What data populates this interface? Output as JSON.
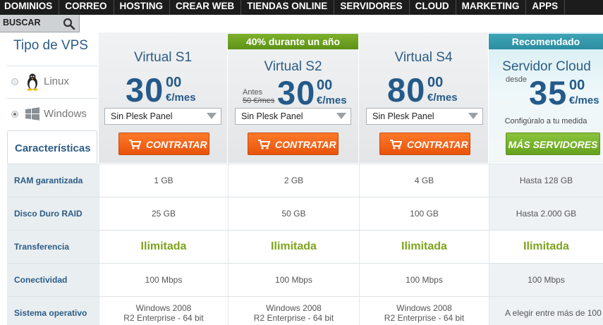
{
  "nav": {
    "items": [
      "DOMINIOS",
      "CORREO",
      "HOSTING",
      "CREAR WEB",
      "TIENDAS ONLINE",
      "SERVIDORES",
      "CLOUD",
      "MARKETING",
      "APPS"
    ]
  },
  "search": {
    "label": "BUSCAR",
    "icon": "search-icon"
  },
  "sidebar": {
    "title": "Tipo de VPS",
    "os_options": [
      {
        "label": "Linux",
        "icon": "linux-icon",
        "selected": false
      },
      {
        "label": "Windows",
        "icon": "windows-icon",
        "selected": true
      }
    ],
    "features_tab": "Características"
  },
  "plans": [
    {
      "name": "Virtual S1",
      "price_int": "30",
      "price_dec": "00",
      "period": "€/mes",
      "select_value": "Sin Plesk Panel",
      "button_label": "CONTRATAR"
    },
    {
      "ribbon": "40% durante un año",
      "name": "Virtual S2",
      "prefix_label": "Antes",
      "prefix_value": "50 €/mes",
      "price_int": "30",
      "price_dec": "00",
      "period": "€/mes",
      "select_value": "Sin Plesk Panel",
      "button_label": "CONTRATAR"
    },
    {
      "name": "Virtual S4",
      "price_int": "80",
      "price_dec": "00",
      "period": "€/mes",
      "select_value": "Sin Plesk Panel",
      "button_label": "CONTRATAR"
    },
    {
      "ribbon": "Recomendado",
      "name": "Servidor Cloud",
      "prefix_label": "desde",
      "price_int": "35",
      "price_dec": "00",
      "period": "€/mes",
      "note": "Configúralo a tu medida",
      "button_label": "MÁS SERVIDORES"
    }
  ],
  "features": {
    "rows": [
      {
        "label": "RAM garantizada",
        "values": [
          "1 GB",
          "2 GB",
          "4 GB",
          "Hasta 128 GB"
        ]
      },
      {
        "label": "Disco Duro RAID",
        "values": [
          "25 GB",
          "50 GB",
          "100 GB",
          "Hasta 2.000 GB"
        ]
      },
      {
        "label": "Transferencia",
        "values": [
          "Ilimitada",
          "Ilimitada",
          "Ilimitada",
          "Ilimitada"
        ]
      },
      {
        "label": "Conectividad",
        "values": [
          "100 Mbps",
          "100 Mbps",
          "100 Mbps",
          "100 Mbps"
        ]
      },
      {
        "label": "Sistema operativo",
        "values": [
          "Windows 2008\nR2 Enterprise - 64 bit",
          "Windows 2008\nR2 Enterprise - 64 bit",
          "Windows 2008\nR2 Enterprise - 64 bit",
          "A elegir entre más de 100"
        ]
      }
    ]
  },
  "colors": {
    "nav_bg": "#1c1c1c",
    "title_blue": "#2c5c86",
    "price_blue": "#245a8a",
    "orange_button": "#f26a1b",
    "green_button": "#76b02a",
    "ribbon_green": "#6fa223",
    "ribbon_teal": "#3399ad",
    "unlimited_green": "#7ea41c"
  }
}
